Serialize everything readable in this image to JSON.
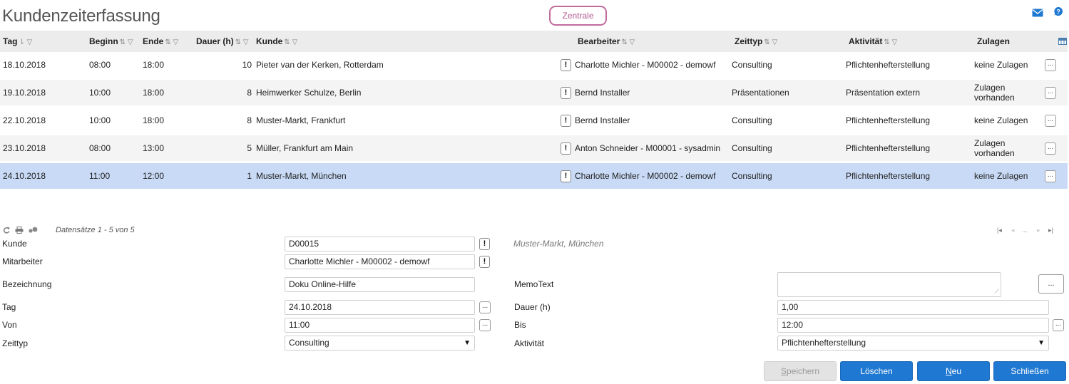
{
  "header": {
    "title": "Kundenzeiterfassung",
    "zentrale_label": "Zentrale",
    "mail_icon": "mail-icon",
    "help_icon": "help-icon"
  },
  "table": {
    "columns": {
      "tag": "Tag",
      "beginn": "Beginn",
      "ende": "Ende",
      "dauer": "Dauer (h)",
      "kunde": "Kunde",
      "bearbeiter": "Bearbeiter",
      "zeittyp": "Zeittyp",
      "aktivitaet": "Aktivität",
      "zulagen": "Zulagen"
    },
    "rows": [
      {
        "tag": "18.10.2018",
        "beginn": "08:00",
        "ende": "18:00",
        "dauer": "10",
        "kunde": "Pieter van der Kerken, Rotterdam",
        "bearbeiter": "Charlotte Michler - M00002 - demowf",
        "zeittyp": "Consulting",
        "aktivitaet": "Pflichtenhefterstellung",
        "zulagen": "keine Zulagen"
      },
      {
        "tag": "19.10.2018",
        "beginn": "10:00",
        "ende": "18:00",
        "dauer": "8",
        "kunde": "Heimwerker Schulze, Berlin",
        "bearbeiter": "Bernd Installer",
        "zeittyp": "Präsentationen",
        "aktivitaet": "Präsentation extern",
        "zulagen": "Zulagen vorhanden"
      },
      {
        "tag": "22.10.2018",
        "beginn": "10:00",
        "ende": "18:00",
        "dauer": "8",
        "kunde": "Muster-Markt, Frankfurt",
        "bearbeiter": "Bernd Installer",
        "zeittyp": "Consulting",
        "aktivitaet": "Pflichtenhefterstellung",
        "zulagen": "keine Zulagen"
      },
      {
        "tag": "23.10.2018",
        "beginn": "08:00",
        "ende": "13:00",
        "dauer": "5",
        "kunde": "Müller, Frankfurt am Main",
        "bearbeiter": "Anton Schneider - M00001 - sysadmin",
        "zeittyp": "Consulting",
        "aktivitaet": "Pflichtenhefterstellung",
        "zulagen": "Zulagen vorhanden"
      },
      {
        "tag": "24.10.2018",
        "beginn": "11:00",
        "ende": "12:00",
        "dauer": "1",
        "kunde": "Muster-Markt, München",
        "bearbeiter": "Charlotte Michler - M00002 - demowf",
        "zeittyp": "Consulting",
        "aktivitaet": "Pflichtenhefterstellung",
        "zulagen": "keine Zulagen"
      }
    ],
    "selected_row": 4,
    "cell_button_label": "!",
    "row_button_label": "..."
  },
  "pager": {
    "info": "Datensätze 1 - 5 von 5",
    "nav_first": "|◂",
    "nav_prev": "◂",
    "nav_pages": "...",
    "nav_next": "▸",
    "nav_last": "▸|"
  },
  "form": {
    "kunde_label": "Kunde",
    "kunde_value": "D00015",
    "kunde_hint": "Muster-Markt, München",
    "mitarbeiter_label": "Mitarbeiter",
    "mitarbeiter_value": "Charlotte Michler - M00002 - demowf",
    "bezeichnung_label": "Bezeichnung",
    "bezeichnung_value": "Doku Online-Hilfe",
    "memotext_label": "MemoText",
    "memotext_value": "",
    "tag_label": "Tag",
    "tag_value": "24.10.2018",
    "dauer_label": "Dauer (h)",
    "dauer_value": "1,00",
    "von_label": "Von",
    "von_value": "11:00",
    "bis_label": "Bis",
    "bis_value": "12:00",
    "zeittyp_label": "Zeittyp",
    "zeittyp_value": "Consulting",
    "aktivitaet_label": "Aktivität",
    "aktivitaet_value": "Pflichtenhefterstellung",
    "excl_label": "!",
    "dots_label": "..."
  },
  "buttons": {
    "speichern_first": "S",
    "speichern_rest": "peichern",
    "loeschen": "Löschen",
    "neu_first": "N",
    "neu_rest": "eu",
    "schliessen": "Schließen"
  },
  "colors": {
    "accent_blue": "#1f78d1",
    "zentrale_border": "#c06a9d",
    "selected_row": "#c8daf5"
  }
}
